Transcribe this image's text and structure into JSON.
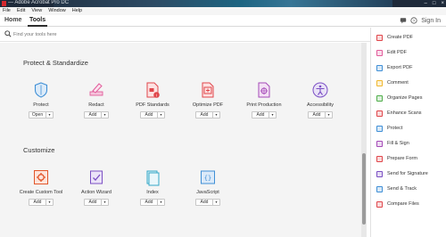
{
  "titlebar": {
    "title": "— Adobe Acrobat Pro DC",
    "minimize": "–",
    "maximize": "□",
    "close": "×"
  },
  "menu": [
    "File",
    "Edit",
    "View",
    "Window",
    "Help"
  ],
  "nav": {
    "home": "Home",
    "tools": "Tools",
    "signin": "Sign In"
  },
  "search": {
    "placeholder": "Find your tools here"
  },
  "sections": {
    "protect": {
      "title": "Protect & Standardize",
      "tools": [
        {
          "label": "Protect",
          "button": "Open"
        },
        {
          "label": "Redact",
          "button": "Add"
        },
        {
          "label": "PDF Standards",
          "button": "Add"
        },
        {
          "label": "Optimize PDF",
          "button": "Add"
        },
        {
          "label": "Print Production",
          "button": "Add"
        },
        {
          "label": "Accessibility",
          "button": "Add"
        }
      ]
    },
    "customize": {
      "title": "Customize",
      "tools": [
        {
          "label": "Create Custom Tool",
          "button": "Add"
        },
        {
          "label": "Action Wizard",
          "button": "Add"
        },
        {
          "label": "Index",
          "button": "Add"
        },
        {
          "label": "JavaScript",
          "button": "Add"
        }
      ]
    }
  },
  "caret": "▾",
  "rightpanel": {
    "items": [
      {
        "label": "Create PDF",
        "icon": "create-pdf-icon",
        "color": "#e0464b"
      },
      {
        "label": "Edit PDF",
        "icon": "edit-pdf-icon",
        "color": "#e25c9b"
      },
      {
        "label": "Export PDF",
        "icon": "export-pdf-icon",
        "color": "#3f8fd6"
      },
      {
        "label": "Comment",
        "icon": "comment-icon",
        "color": "#f0b72e"
      },
      {
        "label": "Organize Pages",
        "icon": "organize-pages-icon",
        "color": "#4fae4a"
      },
      {
        "label": "Enhance Scans",
        "icon": "enhance-scans-icon",
        "color": "#e0464b"
      },
      {
        "label": "Protect",
        "icon": "protect-icon",
        "color": "#3f8fd6"
      },
      {
        "label": "Fill & Sign",
        "icon": "fill-sign-icon",
        "color": "#a54ab8"
      },
      {
        "label": "Prepare Form",
        "icon": "prepare-form-icon",
        "color": "#e0464b"
      },
      {
        "label": "Send for Signature",
        "icon": "send-signature-icon",
        "color": "#7b4fc4"
      },
      {
        "label": "Send & Track",
        "icon": "send-track-icon",
        "color": "#3f8fd6"
      },
      {
        "label": "Compare Files",
        "icon": "compare-files-icon",
        "color": "#e0464b"
      }
    ]
  }
}
